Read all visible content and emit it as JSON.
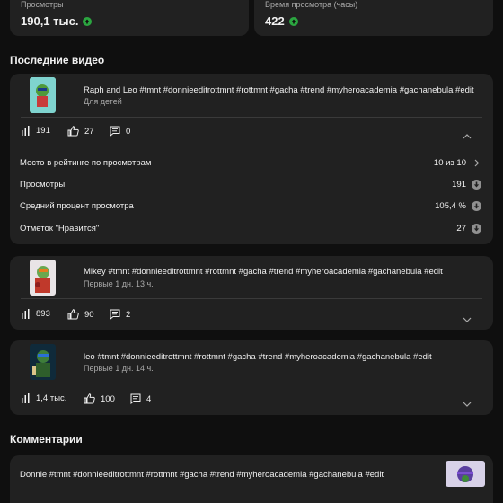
{
  "stats": [
    {
      "label": "Просмотры",
      "value": "190,1 тыс."
    },
    {
      "label": "Время просмотра (часы)",
      "value": "422"
    }
  ],
  "recent_videos": {
    "title": "Последние видео",
    "items": [
      {
        "title": "Raph and Leo #tmnt #donnieeditrottmnt #rottmnt #gacha #trend #myheroacademia #gachanebula #edit",
        "subtitle": "Для детей",
        "views": "191",
        "likes": "27",
        "comments": "0",
        "expanded": true,
        "details": [
          {
            "label": "Место в рейтинге по просмотрам",
            "value": "10 из 10"
          },
          {
            "label": "Просмотры",
            "value": "191"
          },
          {
            "label": "Средний процент просмотра",
            "value": "105,4 %"
          },
          {
            "label": "Отметок \"Нравится\"",
            "value": "27"
          }
        ]
      },
      {
        "title": "Mikey #tmnt #donnieeditrottmnt #rottmnt #gacha #trend #myheroacademia #gachanebula #edit",
        "subtitle": "Первые 1 дн. 13 ч.",
        "views": "893",
        "likes": "90",
        "comments": "2",
        "expanded": false
      },
      {
        "title": "leo #tmnt #donnieeditrottmnt #rottmnt #gacha #trend #myheroacademia #gachanebula #edit",
        "subtitle": "Первые 1 дн. 14 ч.",
        "views": "1,4 тыс.",
        "likes": "100",
        "comments": "4",
        "expanded": false
      }
    ]
  },
  "comments_section": {
    "title": "Комментарии",
    "item": {
      "text": "Donnie #tmnt #donnieeditrottmnt #rottmnt #gacha #trend #myheroacademia #gachanebula #edit"
    }
  },
  "colors": {
    "background": "#0f0f0f",
    "card": "#212121",
    "up_indicator": "#2ba640",
    "secondary_text": "#aaaaaa"
  }
}
